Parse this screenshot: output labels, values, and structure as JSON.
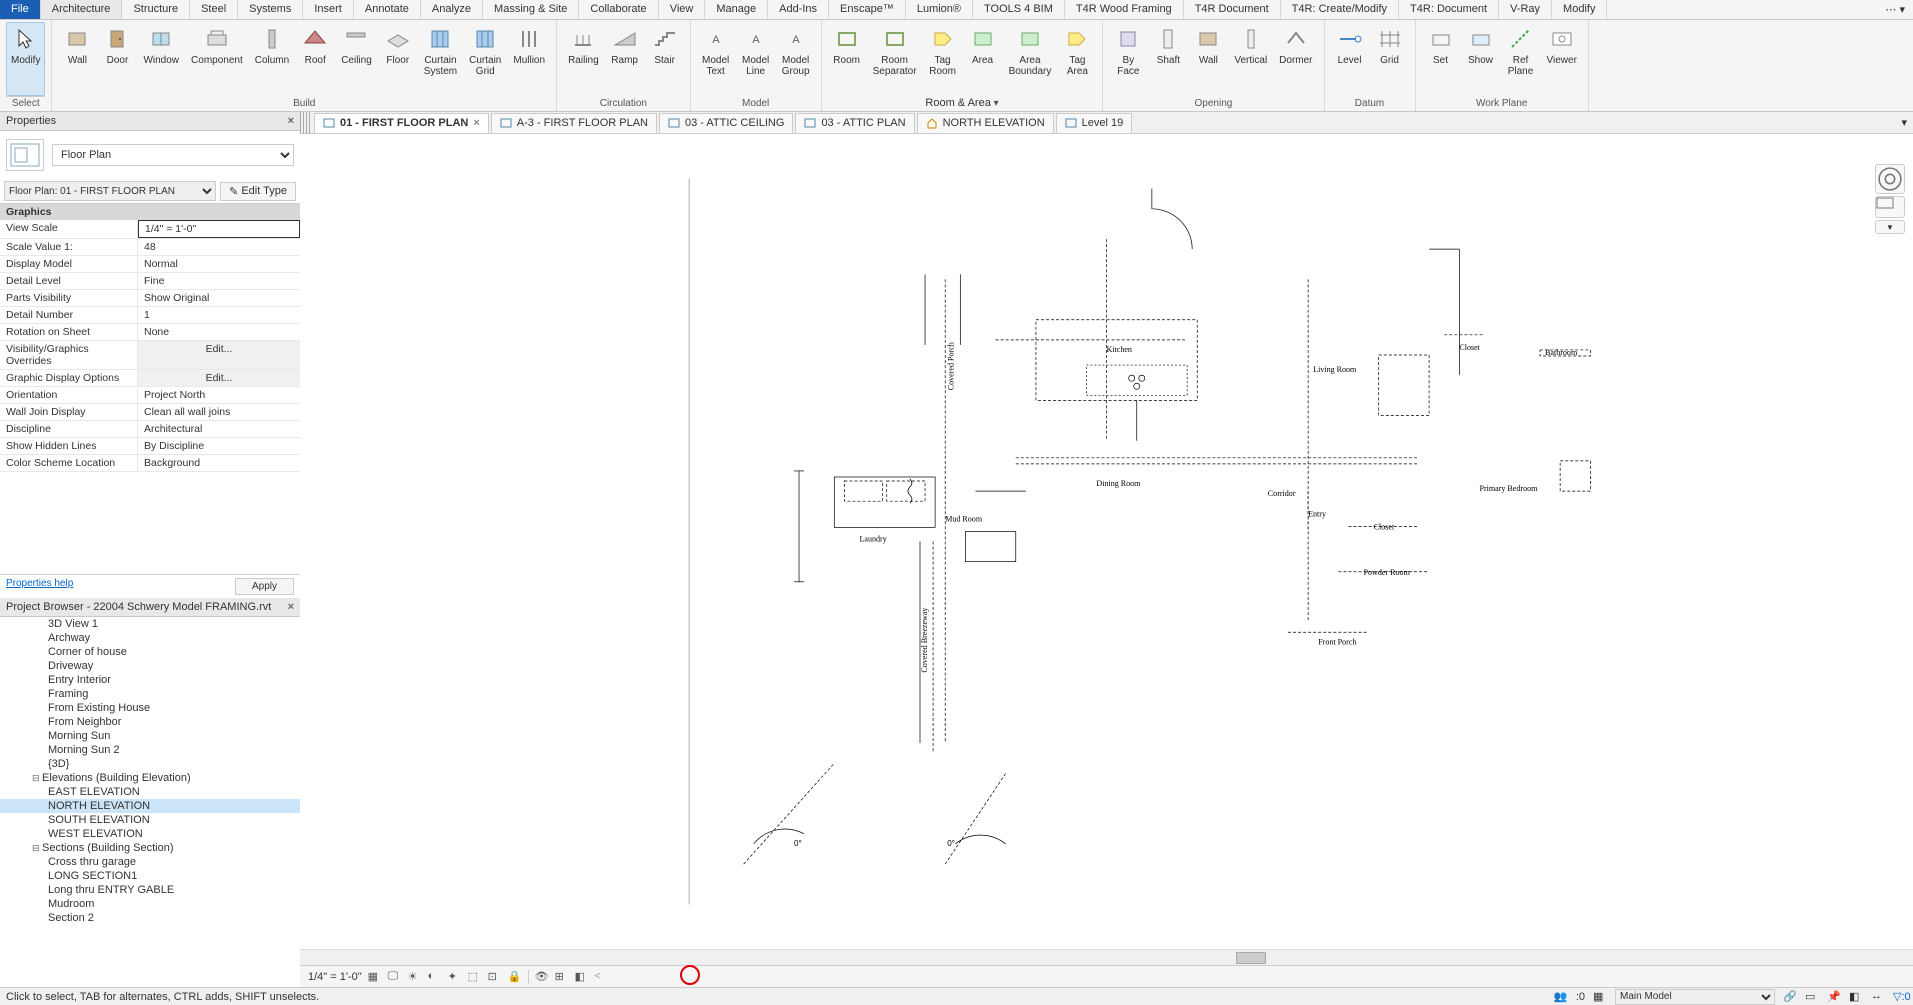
{
  "tabs": [
    "File",
    "Architecture",
    "Structure",
    "Steel",
    "Systems",
    "Insert",
    "Annotate",
    "Analyze",
    "Massing & Site",
    "Collaborate",
    "View",
    "Manage",
    "Add-Ins",
    "Enscape™",
    "Lumion®",
    "TOOLS 4 BIM",
    "T4R Wood Framing",
    "T4R Document",
    "T4R: Create/Modify",
    "T4R: Document",
    "V-Ray",
    "Modify"
  ],
  "active_tab": "Architecture",
  "ribbon": {
    "modify": "Modify",
    "select": "Select",
    "build": {
      "label": "Build",
      "items": [
        "Wall",
        "Door",
        "Window",
        "Component",
        "Column",
        "Roof",
        "Ceiling",
        "Floor",
        "Curtain\nSystem",
        "Curtain\nGrid",
        "Mullion"
      ]
    },
    "circulation": {
      "label": "Circulation",
      "items": [
        "Railing",
        "Ramp",
        "Stair"
      ]
    },
    "model": {
      "label": "Model",
      "items": [
        "Model\nText",
        "Model\nLine",
        "Model\nGroup"
      ]
    },
    "room_area": {
      "label": "Room & Area",
      "items": [
        "Room",
        "Room\nSeparator",
        "Tag\nRoom",
        "Area",
        "Area\nBoundary",
        "Tag\nArea"
      ]
    },
    "opening": {
      "label": "Opening",
      "items": [
        "By\nFace",
        "Shaft",
        "Wall",
        "Vertical",
        "Dormer"
      ]
    },
    "datum": {
      "label": "Datum",
      "items": [
        "Level",
        "Grid"
      ]
    },
    "workplane": {
      "label": "Work Plane",
      "items": [
        "Set",
        "Show",
        "Ref\nPlane",
        "Viewer"
      ]
    }
  },
  "properties": {
    "title": "Properties",
    "type": "Floor Plan",
    "instance": "Floor Plan: 01 - FIRST FLOOR PLAN",
    "edit_type": "Edit Type",
    "cat": "Graphics",
    "rows": [
      {
        "k": "View Scale",
        "v": "1/4\" = 1'-0\"",
        "sel": true
      },
      {
        "k": "Scale Value    1:",
        "v": "48"
      },
      {
        "k": "Display Model",
        "v": "Normal"
      },
      {
        "k": "Detail Level",
        "v": "Fine"
      },
      {
        "k": "Parts Visibility",
        "v": "Show Original"
      },
      {
        "k": "Detail Number",
        "v": "1"
      },
      {
        "k": "Rotation on Sheet",
        "v": "None"
      },
      {
        "k": "Visibility/Graphics Overrides",
        "v": "Edit...",
        "btn": true
      },
      {
        "k": "Graphic Display Options",
        "v": "Edit...",
        "btn": true
      },
      {
        "k": "Orientation",
        "v": "Project North"
      },
      {
        "k": "Wall Join Display",
        "v": "Clean all wall joins"
      },
      {
        "k": "Discipline",
        "v": "Architectural"
      },
      {
        "k": "Show Hidden Lines",
        "v": "By Discipline"
      },
      {
        "k": "Color Scheme Location",
        "v": "Background"
      }
    ],
    "help": "Properties help",
    "apply": "Apply"
  },
  "browser": {
    "title": "Project Browser - 22004 Schwery Model FRAMING.rvt",
    "views": [
      "3D View 1",
      "Archway",
      "Corner of house",
      "Driveway",
      "Entry Interior",
      "Framing",
      "From Existing House",
      "From Neighbor",
      "Morning Sun",
      "Morning Sun 2",
      "{3D}"
    ],
    "elev_group": "Elevations (Building Elevation)",
    "elevations": [
      "EAST ELEVATION",
      "NORTH ELEVATION",
      "SOUTH ELEVATION",
      "WEST ELEVATION"
    ],
    "selected": "NORTH ELEVATION",
    "sect_group": "Sections (Building Section)",
    "sections": [
      "Cross thru garage",
      "LONG SECTION1",
      "Long thru ENTRY GABLE",
      "Mudroom",
      "Section 2"
    ]
  },
  "viewtabs": [
    {
      "label": "01 - FIRST FLOOR PLAN",
      "active": true,
      "closable": true
    },
    {
      "label": "A-3 - FIRST FLOOR PLAN"
    },
    {
      "label": "03 - ATTIC CEILING"
    },
    {
      "label": "03 - ATTIC PLAN"
    },
    {
      "label": "NORTH ELEVATION",
      "icon": "home"
    },
    {
      "label": "Level 19"
    }
  ],
  "rooms": [
    "Kitchen",
    "Living Room",
    "Bathroom",
    "Closet",
    "Dining Room",
    "Corridor",
    "Entry",
    "Closet",
    "Primary Bedroom",
    "Powder Room",
    "Front Porch",
    "Mud Room",
    "Laundry",
    "Covered Porch",
    "Covered Breezeway"
  ],
  "viewctl": {
    "scale": "1/4\" = 1'-0\""
  },
  "status": {
    "text": "Click to select, TAB for alternates, CTRL adds, SHIFT unselects.",
    "sel_count": ":0",
    "model": "Main Model"
  }
}
